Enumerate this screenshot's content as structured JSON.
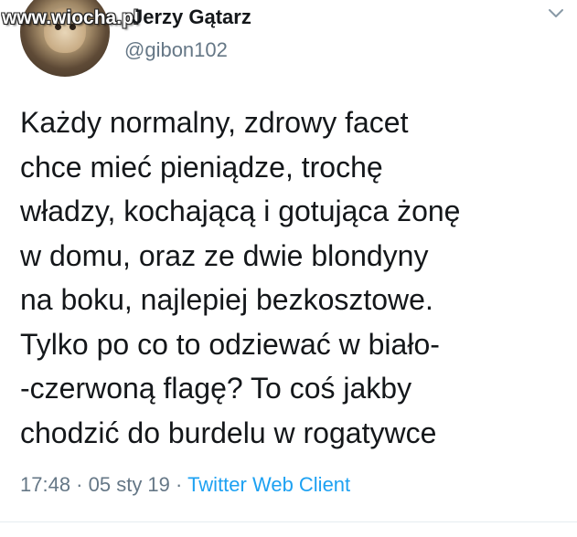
{
  "author": {
    "display_name": "Jerzy Gątarz",
    "handle": "@gibon102"
  },
  "watermark": "www.wiocha.pl",
  "tweet": {
    "lines": [
      "Każdy normalny, zdrowy facet",
      "chce mieć pieniądze, trochę",
      "władzy, kochającą i gotująca żonę",
      "w domu, oraz ze dwie blondyny",
      "na boku, najlepiej bezkosztowe.",
      "Tylko po co to odziewać w biało-",
      "-czerwoną flagę? To coś jakby",
      "chodzić do burdelu w rogatywce"
    ]
  },
  "meta": {
    "time": "17:48",
    "separator": " · ",
    "date": "05 sty 19",
    "source": "Twitter Web Client"
  },
  "icons": {
    "menu": "chevron-down-icon"
  },
  "colors": {
    "text": "#14171a",
    "secondary": "#657786",
    "link": "#1da1f2"
  }
}
